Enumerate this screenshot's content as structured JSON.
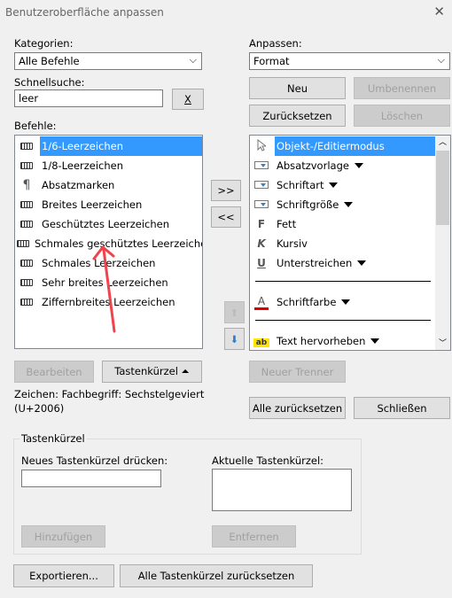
{
  "window": {
    "title": "Benutzeroberfläche anpassen",
    "close": "✕"
  },
  "left": {
    "categories_label": "Kategorien:",
    "categories_value": "Alle Befehle",
    "search_label": "Schnellsuche:",
    "search_value": "leer",
    "clear_button": "X",
    "commands_label": "Befehle:",
    "commands": [
      {
        "label": "1/6-Leerzeichen",
        "icon": "keyboard-icon",
        "selected": true
      },
      {
        "label": "1/8-Leerzeichen",
        "icon": "keyboard-icon"
      },
      {
        "label": "Absatzmarken",
        "icon": "pilcrow-icon"
      },
      {
        "label": "Breites Leerzeichen",
        "icon": "keyboard-icon"
      },
      {
        "label": "Geschütztes Leerzeichen",
        "icon": "keyboard-icon"
      },
      {
        "label": "Schmales geschütztes Leerzeichen",
        "icon": "keyboard-icon"
      },
      {
        "label": "Schmales Leerzeichen",
        "icon": "keyboard-icon"
      },
      {
        "label": "Sehr breites Leerzeichen",
        "icon": "keyboard-icon"
      },
      {
        "label": "Ziffernbreites Leerzeichen",
        "icon": "keyboard-icon"
      }
    ],
    "edit_button": "Bearbeiten",
    "shortcut_button": "Tastenkürzel ⏶",
    "info_line1": "Zeichen: Fachbegriff: Sechstelgeviert",
    "info_line2": "(U+2006)"
  },
  "middle": {
    "add_button": ">>",
    "remove_button": "<<"
  },
  "right": {
    "customize_label": "Anpassen:",
    "customize_value": "Format",
    "new_button": "Neu",
    "rename_button": "Umbenennen",
    "reset_button": "Zurücksetzen",
    "delete_button": "Löschen",
    "items": [
      {
        "label": "Objekt-/Editiermodus",
        "icon": "cursor-icon",
        "selected": true
      },
      {
        "label": "Absatzvorlage",
        "icon": "dropdown-box-icon",
        "dropdown": true
      },
      {
        "label": "Schriftart",
        "icon": "dropdown-box-icon",
        "dropdown": true
      },
      {
        "label": "Schriftgröße",
        "icon": "dropdown-box-icon",
        "dropdown": true
      },
      {
        "label": "Fett",
        "icon": "bold-icon",
        "glyph": "F"
      },
      {
        "label": "Kursiv",
        "icon": "italic-icon",
        "glyph": "K"
      },
      {
        "label": "Unterstreichen",
        "icon": "underline-icon",
        "glyph": "U",
        "dropdown": true
      },
      {
        "separator": true
      },
      {
        "label": "Schriftfarbe",
        "icon": "font-color-icon",
        "glyph": "A",
        "dropdown": true
      },
      {
        "separator": true
      },
      {
        "label": "Text hervorheben",
        "icon": "highlight-icon",
        "glyph": "ab",
        "dropdown": true
      }
    ],
    "new_separator_button": "Neuer Trenner",
    "reset_all_button": "Alle zurücksetzen",
    "close_button": "Schließen"
  },
  "shortcuts": {
    "group_label": "Tastenkürzel",
    "new_label": "Neues Tastenkürzel drücken:",
    "new_value": "",
    "current_label": "Aktuelle Tastenkürzel:",
    "add_button": "Hinzufügen",
    "remove_button": "Entfernen"
  },
  "footer": {
    "export_button": "Exportieren...",
    "reset_shortcuts_button": "Alle Tastenkürzel zurücksetzen"
  },
  "colors": {
    "selection": "#3399ff",
    "annotation_arrow": "#f0444c",
    "font_color_bar": "#e00000",
    "highlight": "#ffe600"
  }
}
